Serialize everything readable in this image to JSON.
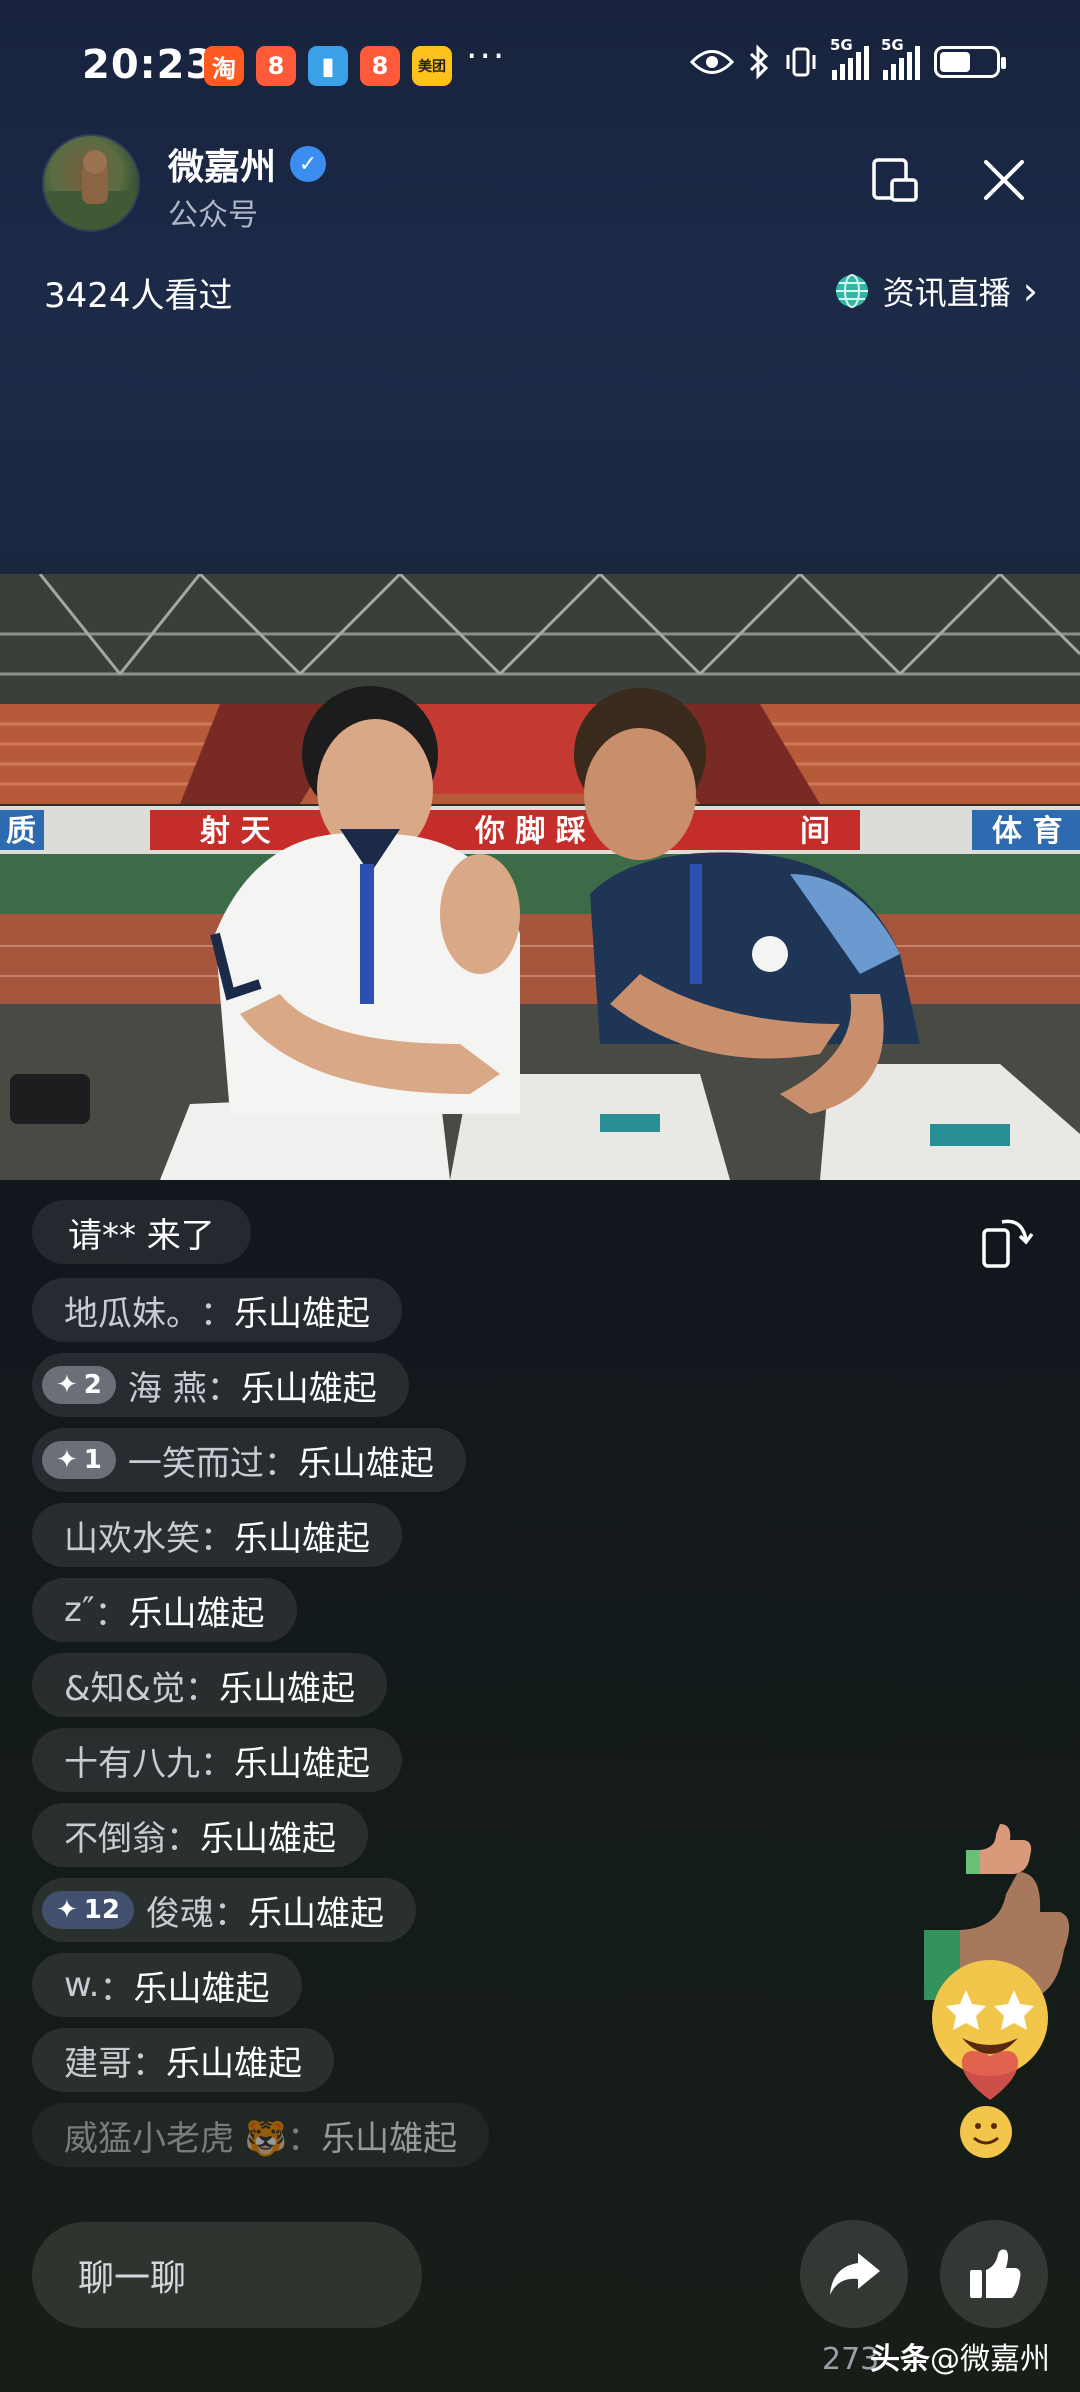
{
  "status_bar": {
    "time": "20:23",
    "app_icons": [
      {
        "name": "taobao-icon",
        "glyph": "淘",
        "color": "#ff5a1f"
      },
      {
        "name": "app-icon-orange",
        "glyph": "8",
        "color": "#ff5a3a"
      },
      {
        "name": "book-app-icon",
        "glyph": "▮",
        "color": "#3aa0e8"
      },
      {
        "name": "app-icon-orange-2",
        "glyph": "8",
        "color": "#ff5a3a"
      },
      {
        "name": "meituan-icon",
        "glyph": "美团",
        "color": "#ffc21a"
      }
    ],
    "more": "···",
    "signal_label_1": "5G",
    "signal_label_2": "5G",
    "battery_level": 0.55
  },
  "header": {
    "account_name": "微嘉州",
    "account_type": "公众号",
    "viewers": "3424人看过",
    "live_news_label": "资讯直播",
    "live_news_chevron": "›"
  },
  "video": {
    "banner_text_left": "射 天",
    "banner_text_middle": "你 脚 踩",
    "banner_text_right": "间",
    "sign_right": "体 育",
    "sign_left": "质"
  },
  "join_notice": "请** 来了",
  "comments": [
    {
      "level": "",
      "level_style": "",
      "user": "地瓜妹。",
      "text": "乐山雄起"
    },
    {
      "level": "2",
      "level_style": "gray",
      "user": "海 燕",
      "text": "乐山雄起"
    },
    {
      "level": "1",
      "level_style": "gray",
      "user": "一笑而过",
      "text": "乐山雄起"
    },
    {
      "level": "",
      "level_style": "",
      "user": "山欢水笑",
      "text": "乐山雄起"
    },
    {
      "level": "",
      "level_style": "",
      "user": "z″",
      "text": "乐山雄起"
    },
    {
      "level": "",
      "level_style": "",
      "user": "&知&觉",
      "text": "乐山雄起"
    },
    {
      "level": "",
      "level_style": "",
      "user": "十有八九",
      "text": "乐山雄起"
    },
    {
      "level": "",
      "level_style": "",
      "user": "不倒翁",
      "text": "乐山雄起"
    },
    {
      "level": "12",
      "level_style": "blue",
      "user": "俊魂",
      "text": "乐山雄起"
    },
    {
      "level": "",
      "level_style": "",
      "user": "w.",
      "text": "乐山雄起"
    },
    {
      "level": "",
      "level_style": "",
      "user": "建哥",
      "text": "乐山雄起"
    },
    {
      "level": "",
      "level_style": "",
      "user": "威猛小老虎 🐯",
      "text": "乐山雄起"
    }
  ],
  "comment_separator": "：",
  "bottom": {
    "chat_placeholder": "聊一聊",
    "like_count": "273",
    "watermark_brand": "头条",
    "watermark_account": "@微嘉州"
  }
}
